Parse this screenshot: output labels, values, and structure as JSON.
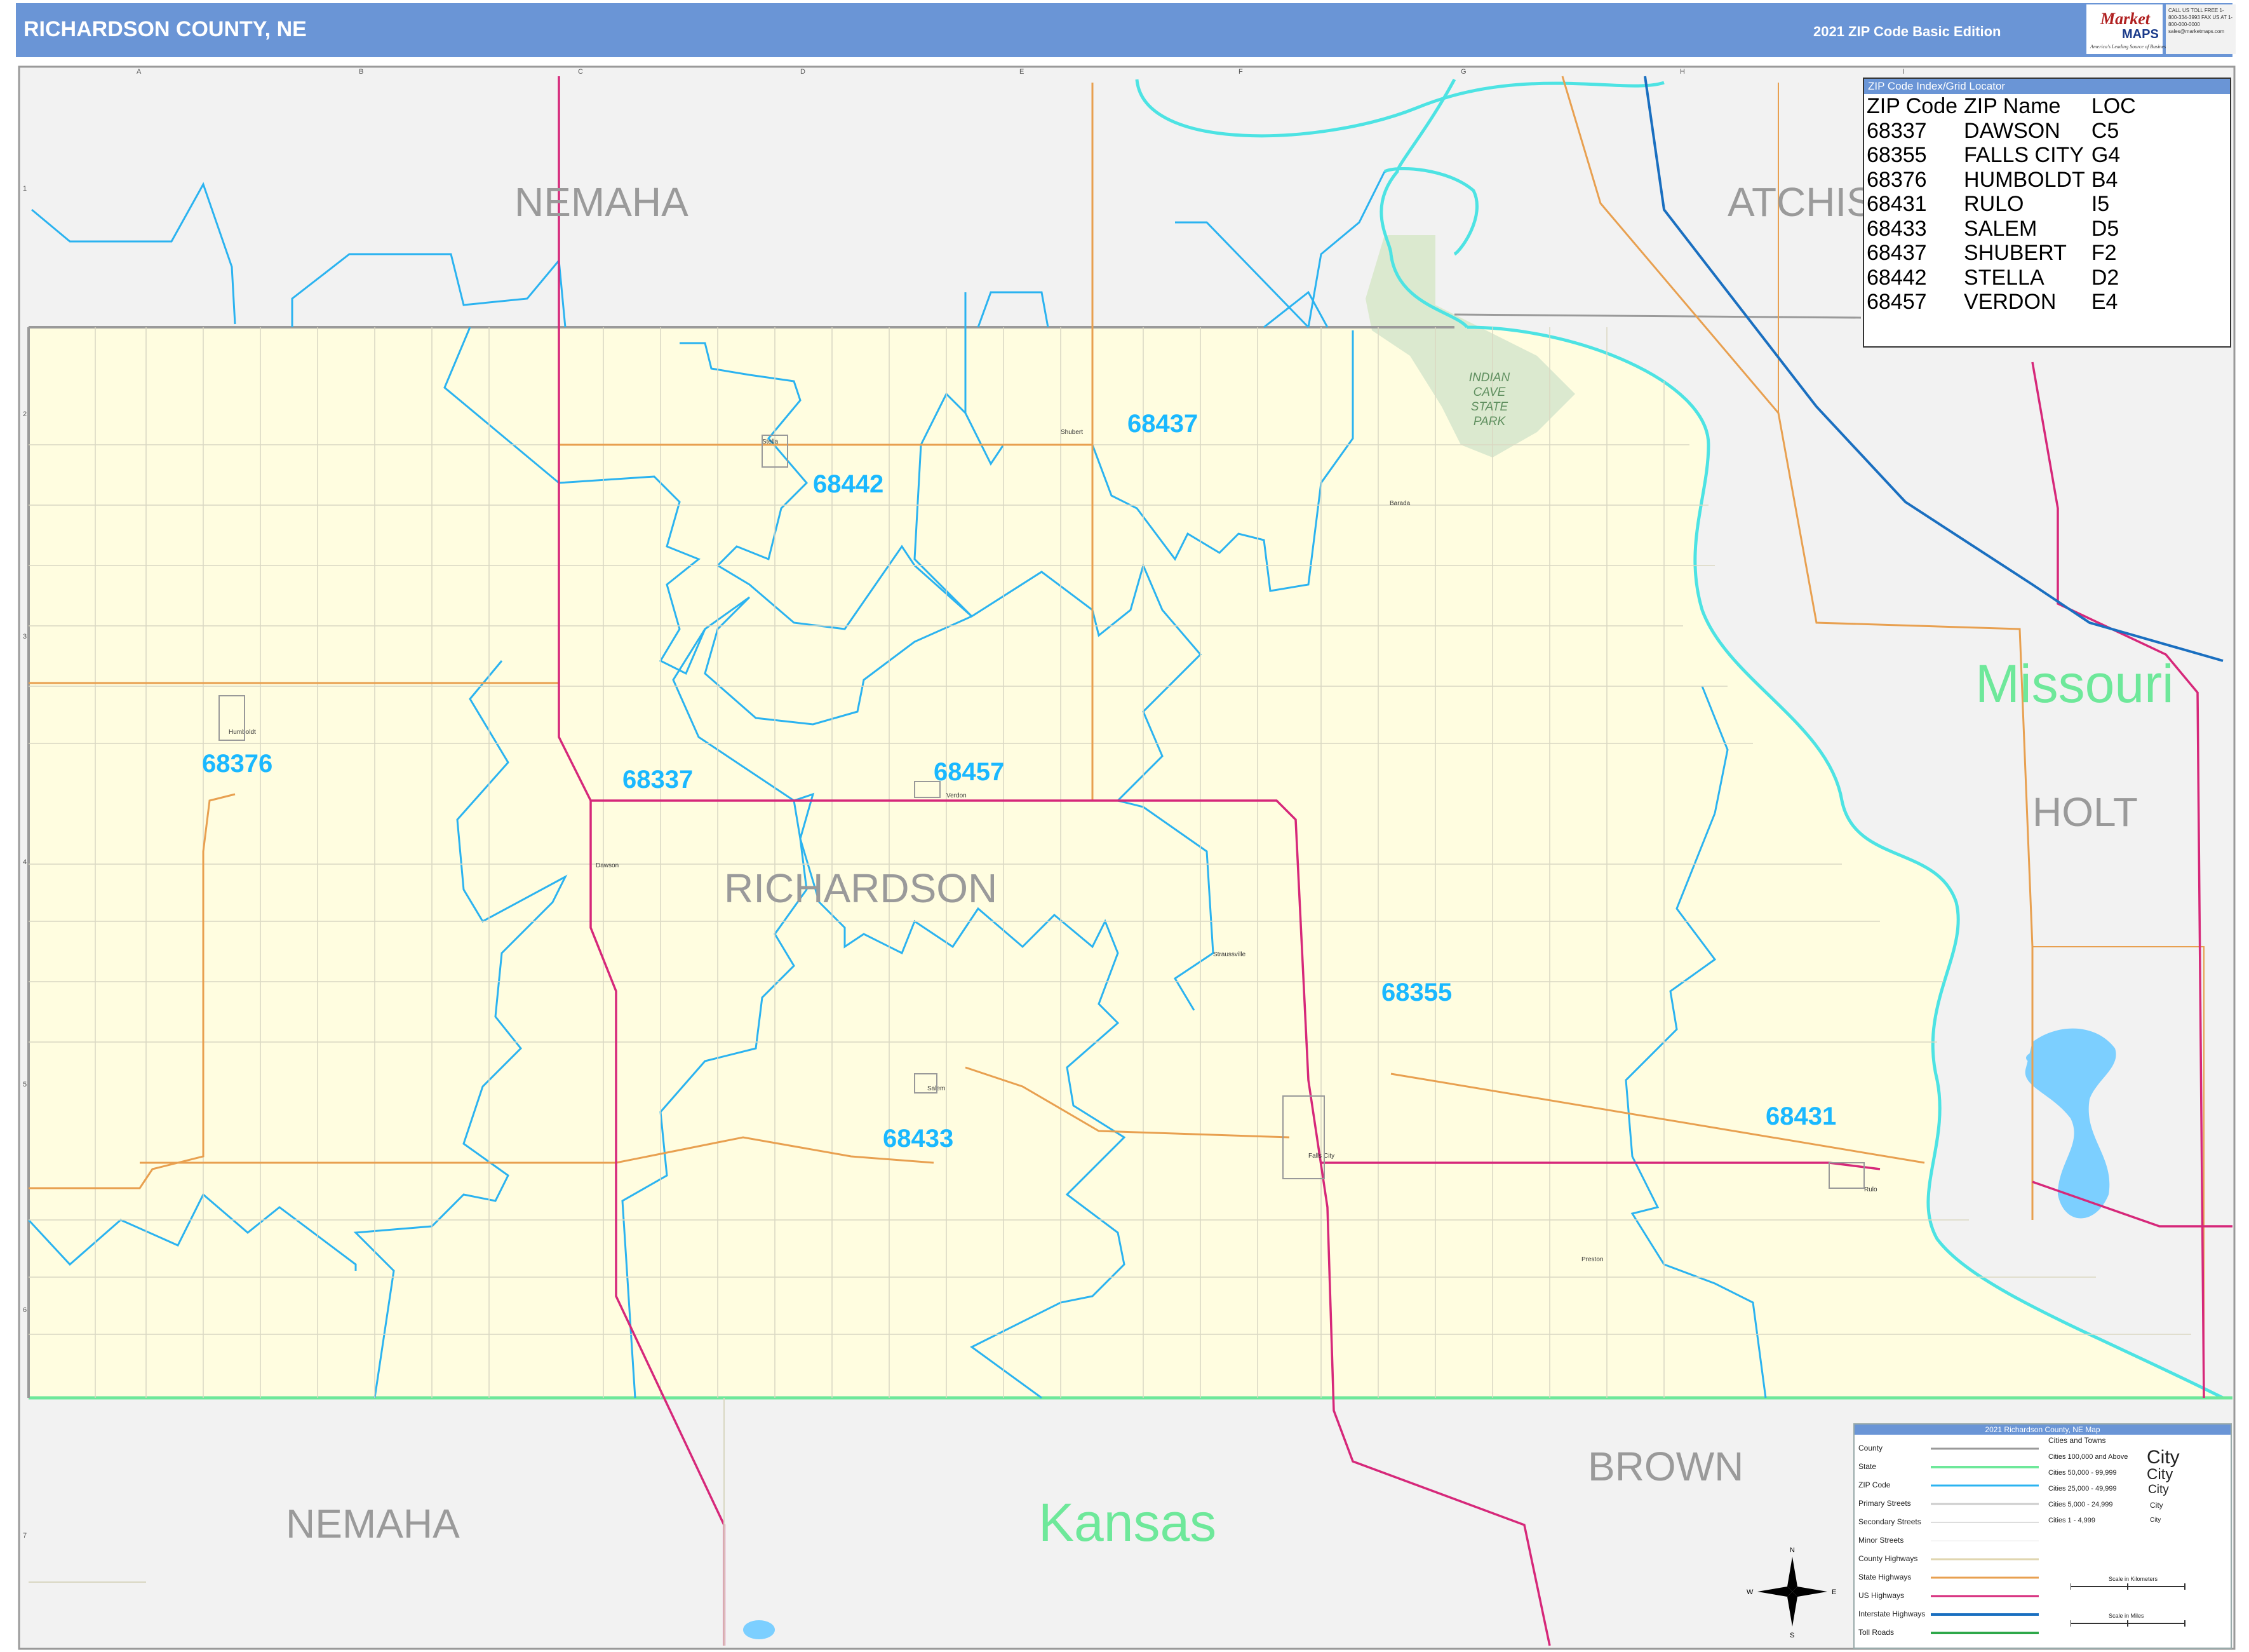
{
  "header": {
    "title": "RICHARDSON COUNTY, NE",
    "edition": "2021 ZIP Code Basic Edition",
    "logo_brand": "Market",
    "logo_brand2": "MAPS",
    "logo_tagline": "America's Leading Source of Business Maps",
    "logo_contact": "CALL US TOLL FREE 1-800-334-3993 FAX US AT 1-800-000-0000 sales@marketmaps.com"
  },
  "map": {
    "grid_columns": [
      "A",
      "B",
      "C",
      "D",
      "E",
      "F",
      "G",
      "H",
      "I"
    ],
    "grid_rows": [
      "1",
      "2",
      "3",
      "4",
      "5",
      "6",
      "7"
    ],
    "labels": {
      "county_nemaha_ne": "NEMAHA",
      "county_atchison": "ATCHISON",
      "county_richardson": "RICHARDSON",
      "county_holt": "HOLT",
      "county_brown": "BROWN",
      "county_nemaha_ks": "NEMAHA",
      "state_missouri": "Missouri",
      "state_kansas": "Kansas",
      "park": "INDIAN CAVE STATE PARK",
      "park_line1": "INDIAN",
      "park_line2": "CAVE",
      "park_line3": "STATE",
      "park_line4": "PARK"
    },
    "zip_labels": [
      "68437",
      "68442",
      "68376",
      "68337",
      "68457",
      "68355",
      "68433",
      "68431"
    ],
    "cities": [
      "Shubert",
      "Stella",
      "Barada",
      "Humboldt",
      "Verdon",
      "Dawson",
      "Salem",
      "Falls City",
      "Rulo",
      "Preston",
      "Straussville"
    ],
    "colors": {
      "county_fill": "#fffde0",
      "outside_fill": "#f2f2f2",
      "zip_boundary": "#2bb3f0",
      "county_boundary": "#9a9a9a",
      "state_boundary": "#6ee89a",
      "river": "#4de3e3",
      "us_highway": "#d6287a",
      "state_highway": "#e8a050",
      "interstate": "#1a6fc0",
      "water": "#7ccfff",
      "park": "#dbe9cf",
      "zip_label": "#1ab8ff"
    }
  },
  "zip_index": {
    "title": "ZIP Code Index/Grid Locator",
    "columns": [
      "ZIP Code",
      "ZIP Name",
      "LOC"
    ],
    "rows": [
      [
        "68337",
        "DAWSON",
        "C5"
      ],
      [
        "68355",
        "FALLS CITY",
        "G4"
      ],
      [
        "68376",
        "HUMBOLDT",
        "B4"
      ],
      [
        "68431",
        "RULO",
        "I5"
      ],
      [
        "68433",
        "SALEM",
        "D5"
      ],
      [
        "68437",
        "SHUBERT",
        "F2"
      ],
      [
        "68442",
        "STELLA",
        "D2"
      ],
      [
        "68457",
        "VERDON",
        "E4"
      ]
    ]
  },
  "legend": {
    "title": "2021 Richardson County, NE Map",
    "line_items": [
      "County",
      "State",
      "ZIP Code",
      "Primary Streets",
      "Secondary Streets",
      "Minor Streets",
      "County Highways",
      "State Highways",
      "US Highways",
      "Interstate Highways",
      "Toll Roads"
    ],
    "city_header": "Cities and Towns",
    "city_items": [
      "Cities 100,000 and Above",
      "Cities 50,000 - 99,999",
      "Cities 25,000 - 49,999",
      "Cities 5,000 - 24,999",
      "Cities 1 - 4,999"
    ],
    "city_samples": [
      "City",
      "City",
      "City",
      "City",
      "City"
    ],
    "scale_km": "Scale in Kilometers",
    "scale_mi": "Scale in Miles",
    "compass": [
      "N",
      "E",
      "S",
      "W"
    ]
  }
}
